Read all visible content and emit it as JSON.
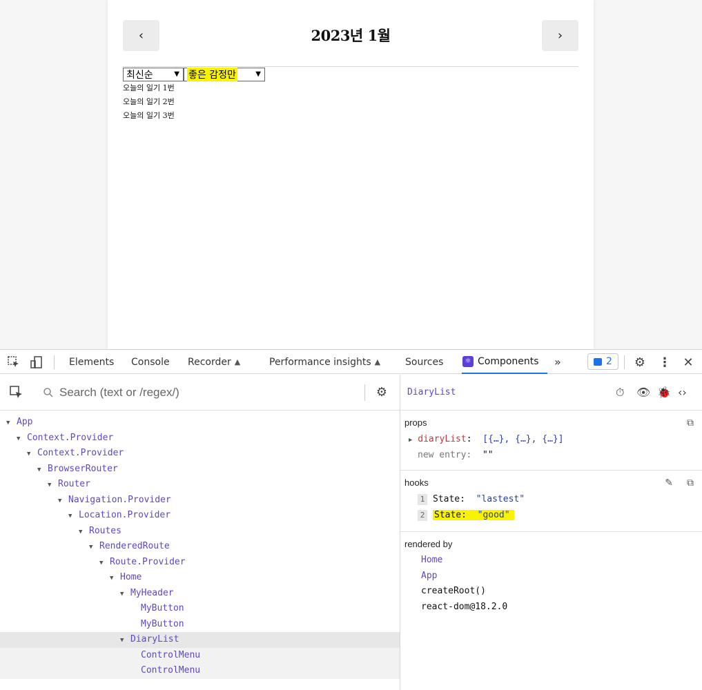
{
  "app": {
    "prev_label": "‹",
    "next_label": "›",
    "title": "2023년 1월",
    "sort_select": "최신순",
    "filter_select": "좋은 감정만",
    "diary_items": [
      "오늘의 일기 1번",
      "오늘의 일기 2번",
      "오늘의 일기 3번"
    ]
  },
  "devtools": {
    "tabs": [
      "Elements",
      "Console",
      "Recorder",
      "Performance insights",
      "Sources",
      "Components"
    ],
    "more_label": "»",
    "badge_count": "2",
    "search_placeholder": "Search (text or /regex/)",
    "tree": [
      {
        "label": "App",
        "depth": 0,
        "caret": true
      },
      {
        "label": "Context.Provider",
        "depth": 1,
        "caret": true
      },
      {
        "label": "Context.Provider",
        "depth": 2,
        "caret": true
      },
      {
        "label": "BrowserRouter",
        "depth": 3,
        "caret": true
      },
      {
        "label": "Router",
        "depth": 4,
        "caret": true
      },
      {
        "label": "Navigation.Provider",
        "depth": 5,
        "caret": true
      },
      {
        "label": "Location.Provider",
        "depth": 6,
        "caret": true
      },
      {
        "label": "Routes",
        "depth": 7,
        "caret": true
      },
      {
        "label": "RenderedRoute",
        "depth": 8,
        "caret": true
      },
      {
        "label": "Route.Provider",
        "depth": 9,
        "caret": true
      },
      {
        "label": "Home",
        "depth": 10,
        "caret": true
      },
      {
        "label": "MyHeader",
        "depth": 11,
        "caret": true
      },
      {
        "label": "MyButton",
        "depth": 12,
        "caret": false
      },
      {
        "label": "MyButton",
        "depth": 12,
        "caret": false
      },
      {
        "label": "DiaryList",
        "depth": 11,
        "caret": true,
        "selected": true
      },
      {
        "label": "ControlMenu",
        "depth": 12,
        "caret": false,
        "sub": true
      },
      {
        "label": "ControlMenu",
        "depth": 12,
        "caret": false,
        "sub": true
      }
    ],
    "selected_component": "DiaryList",
    "props_title": "props",
    "props": [
      {
        "key": "diaryList",
        "sep": ":",
        "value": "[{…}, {…}, {…}]"
      },
      {
        "key": "new entry",
        "sep": ":",
        "value": "\"\""
      }
    ],
    "hooks_title": "hooks",
    "hooks": [
      {
        "num": "1",
        "key": "State:",
        "value": "\"lastest\""
      },
      {
        "num": "2",
        "key": "State:",
        "value": "\"good\""
      }
    ],
    "rendered_by_title": "rendered by",
    "rendered_by": [
      {
        "label": "Home",
        "link": true
      },
      {
        "label": "App",
        "link": true
      },
      {
        "label": "createRoot()",
        "link": false
      },
      {
        "label": "react-dom@18.2.0",
        "link": false
      }
    ],
    "highlight_color": "#f9f300",
    "accent_color": "#1a73e8",
    "component_color": "#5a48c9"
  }
}
